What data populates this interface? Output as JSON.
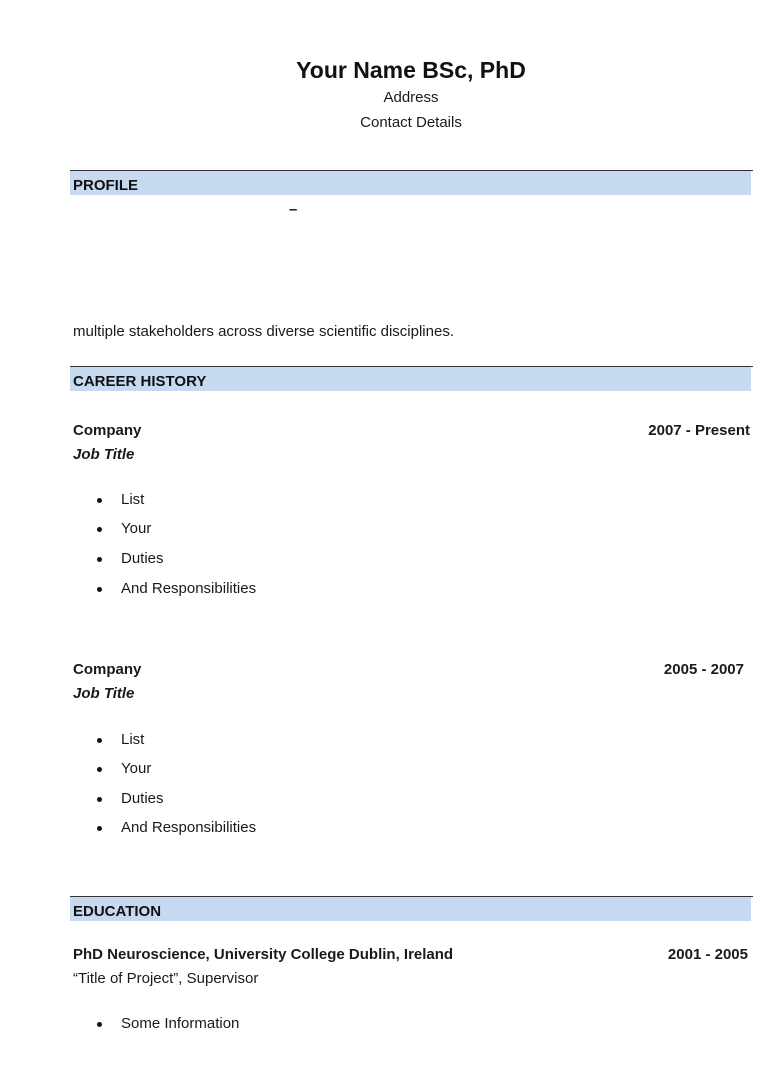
{
  "header": {
    "name": "Your Name BSc, PhD",
    "address": "Address",
    "contact": "Contact Details"
  },
  "profile": {
    "heading": "PROFILE",
    "dash": "–",
    "text": "multiple stakeholders across diverse scientific disciplines."
  },
  "career": {
    "heading": "CAREER HISTORY",
    "jobs": [
      {
        "company": "Company",
        "dates": "2007 - Present",
        "title": "Job Title",
        "duties": [
          "List",
          "Your",
          "Duties",
          "And Responsibilities"
        ]
      },
      {
        "company": "Company",
        "dates": "2005 - 2007",
        "title": "Job Title",
        "duties": [
          "List",
          "Your",
          "Duties",
          "And Responsibilities"
        ]
      }
    ]
  },
  "education": {
    "heading": "EDUCATION",
    "degree": "PhD Neuroscience, University College Dublin, Ireland",
    "dates": "2001 - 2005",
    "project": "“Title of Project”, Supervisor",
    "info": [
      "Some Information"
    ]
  }
}
